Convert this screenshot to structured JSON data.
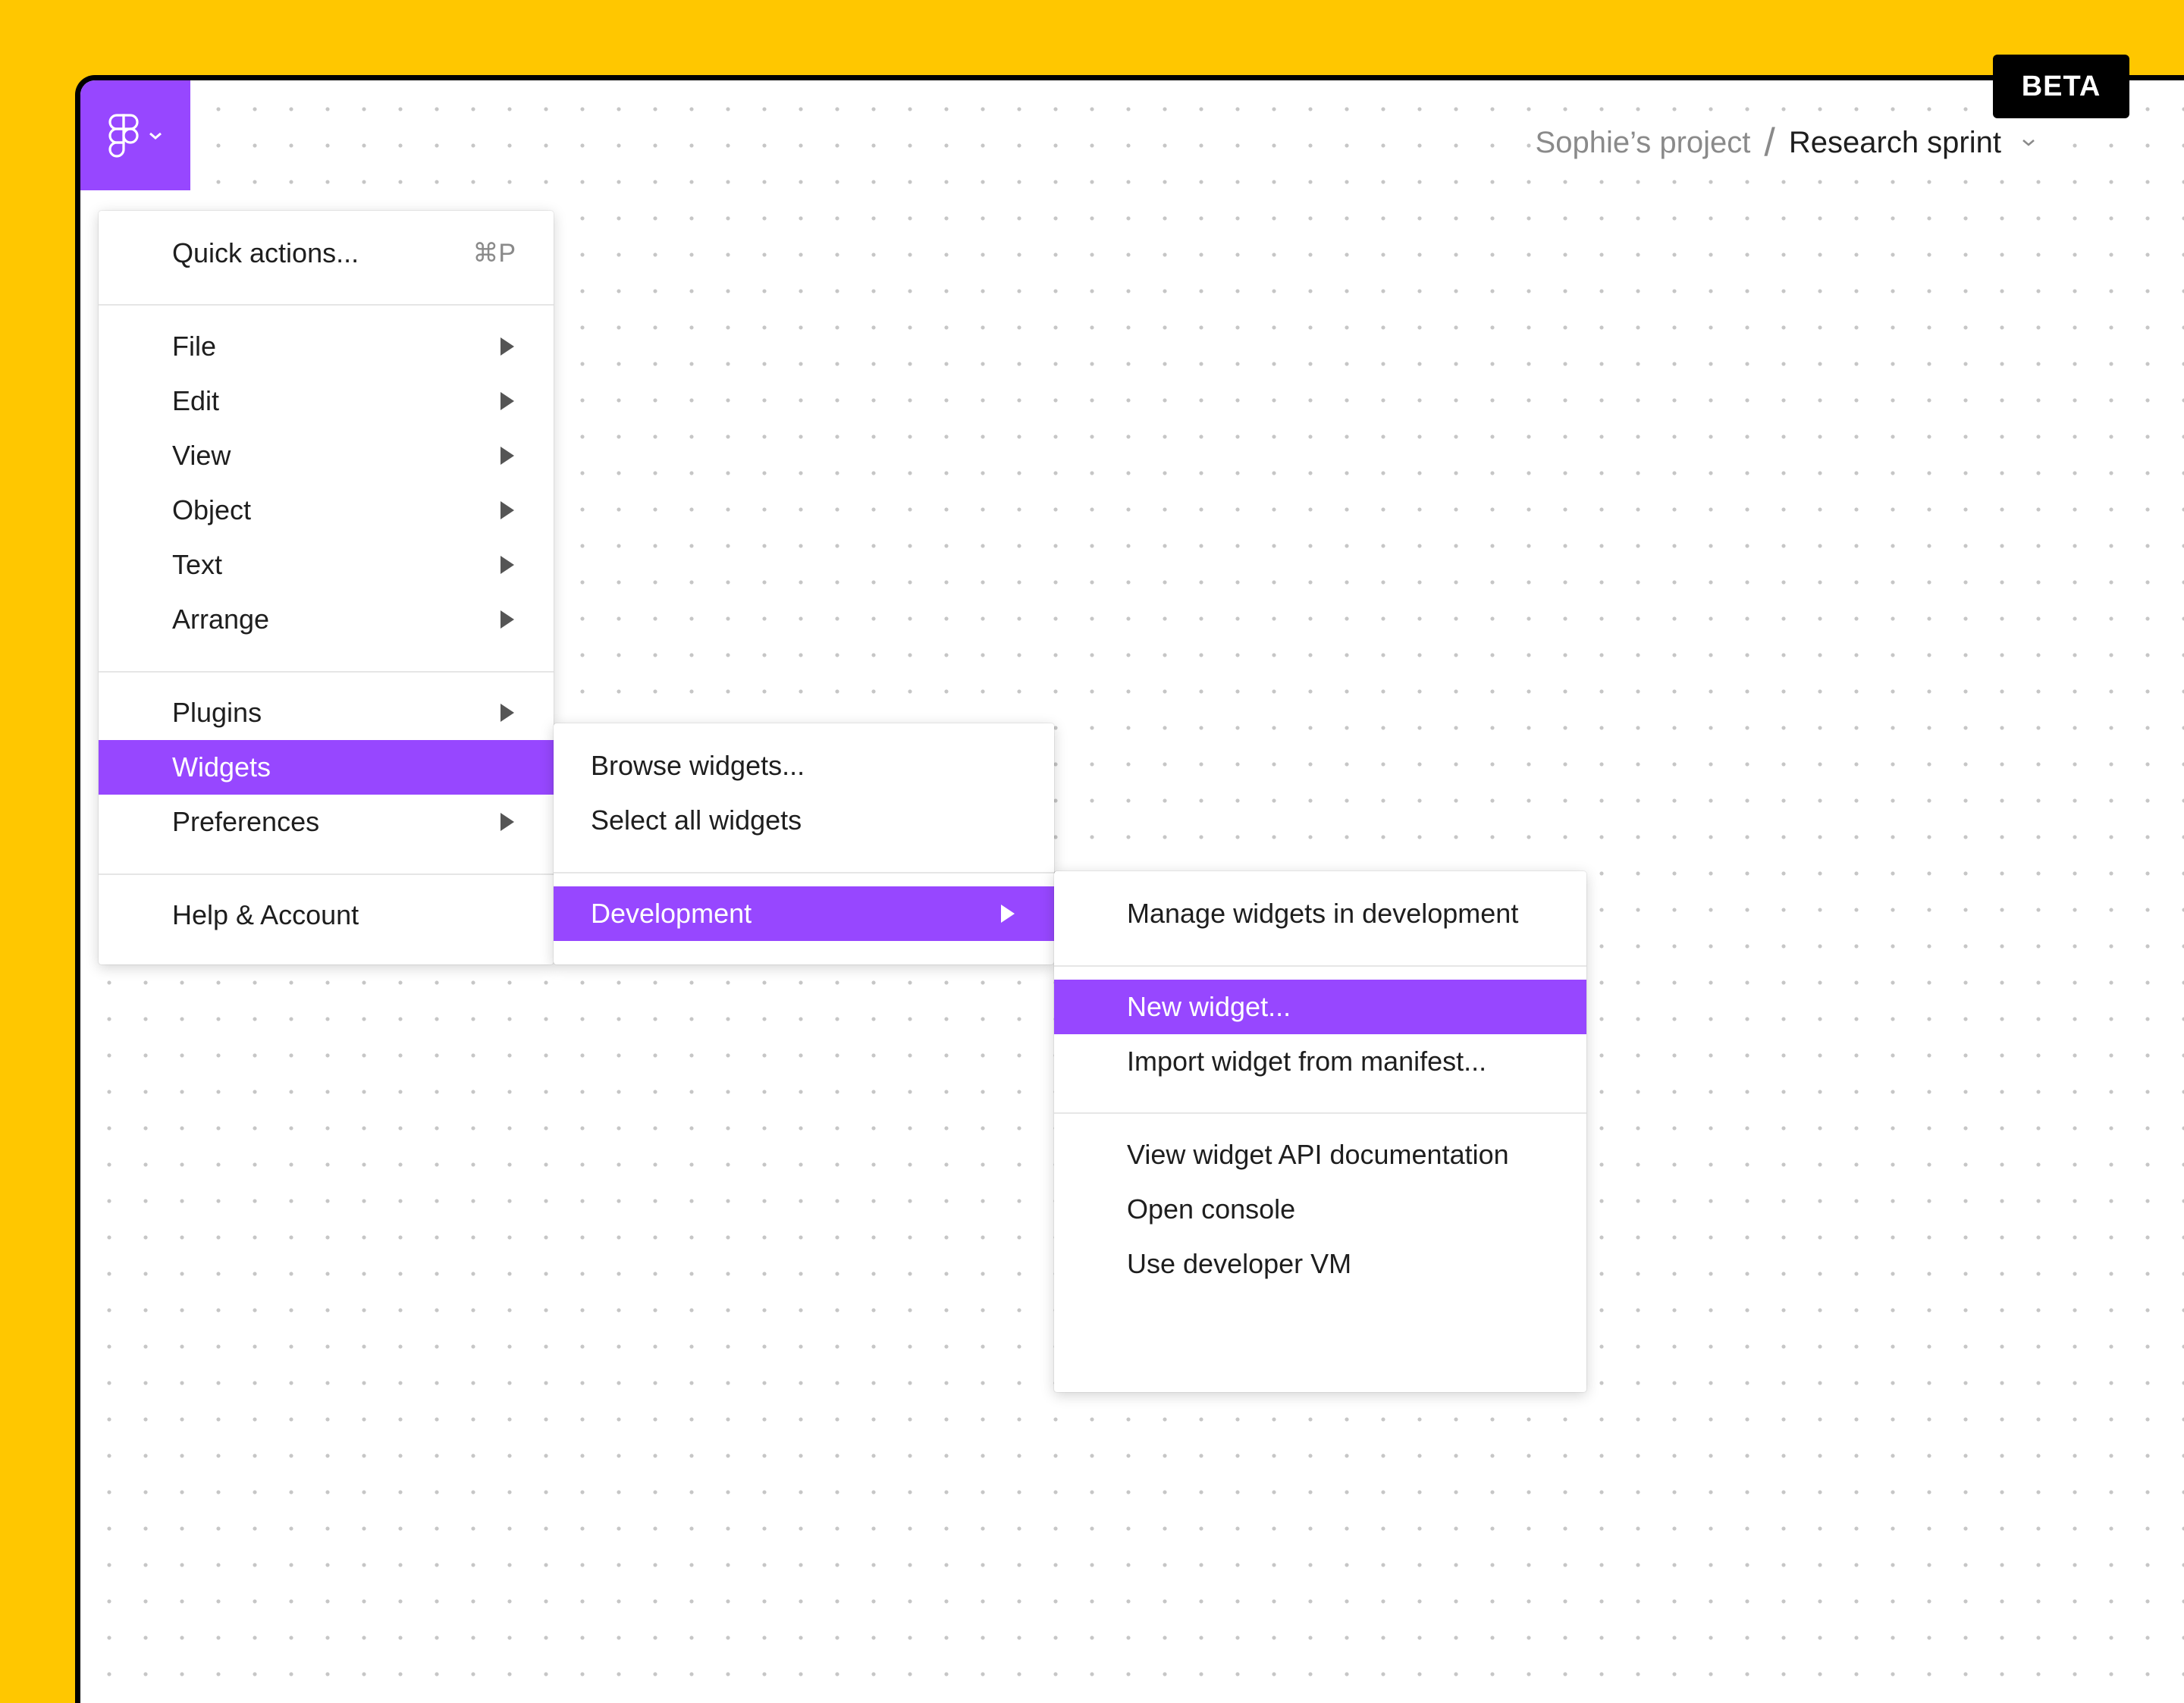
{
  "header": {
    "project": "Sophie’s project",
    "separator": "/",
    "file": "Research sprint",
    "badge": "BETA"
  },
  "colors": {
    "accent": "#9747FF",
    "background": "#FFC700"
  },
  "main_menu": {
    "quick_actions": {
      "label": "Quick actions...",
      "shortcut": "⌘P"
    },
    "file": "File",
    "edit": "Edit",
    "view": "View",
    "object": "Object",
    "text": "Text",
    "arrange": "Arrange",
    "plugins": "Plugins",
    "widgets": "Widgets",
    "preferences": "Preferences",
    "help": "Help & Account"
  },
  "widgets_menu": {
    "browse": "Browse widgets...",
    "select_all": "Select all widgets",
    "development": "Development"
  },
  "development_menu": {
    "manage": "Manage widgets in development",
    "new_widget": "New widget...",
    "import": "Import widget from manifest...",
    "docs": "View widget API documentation",
    "console": "Open console",
    "vm": "Use developer VM"
  }
}
